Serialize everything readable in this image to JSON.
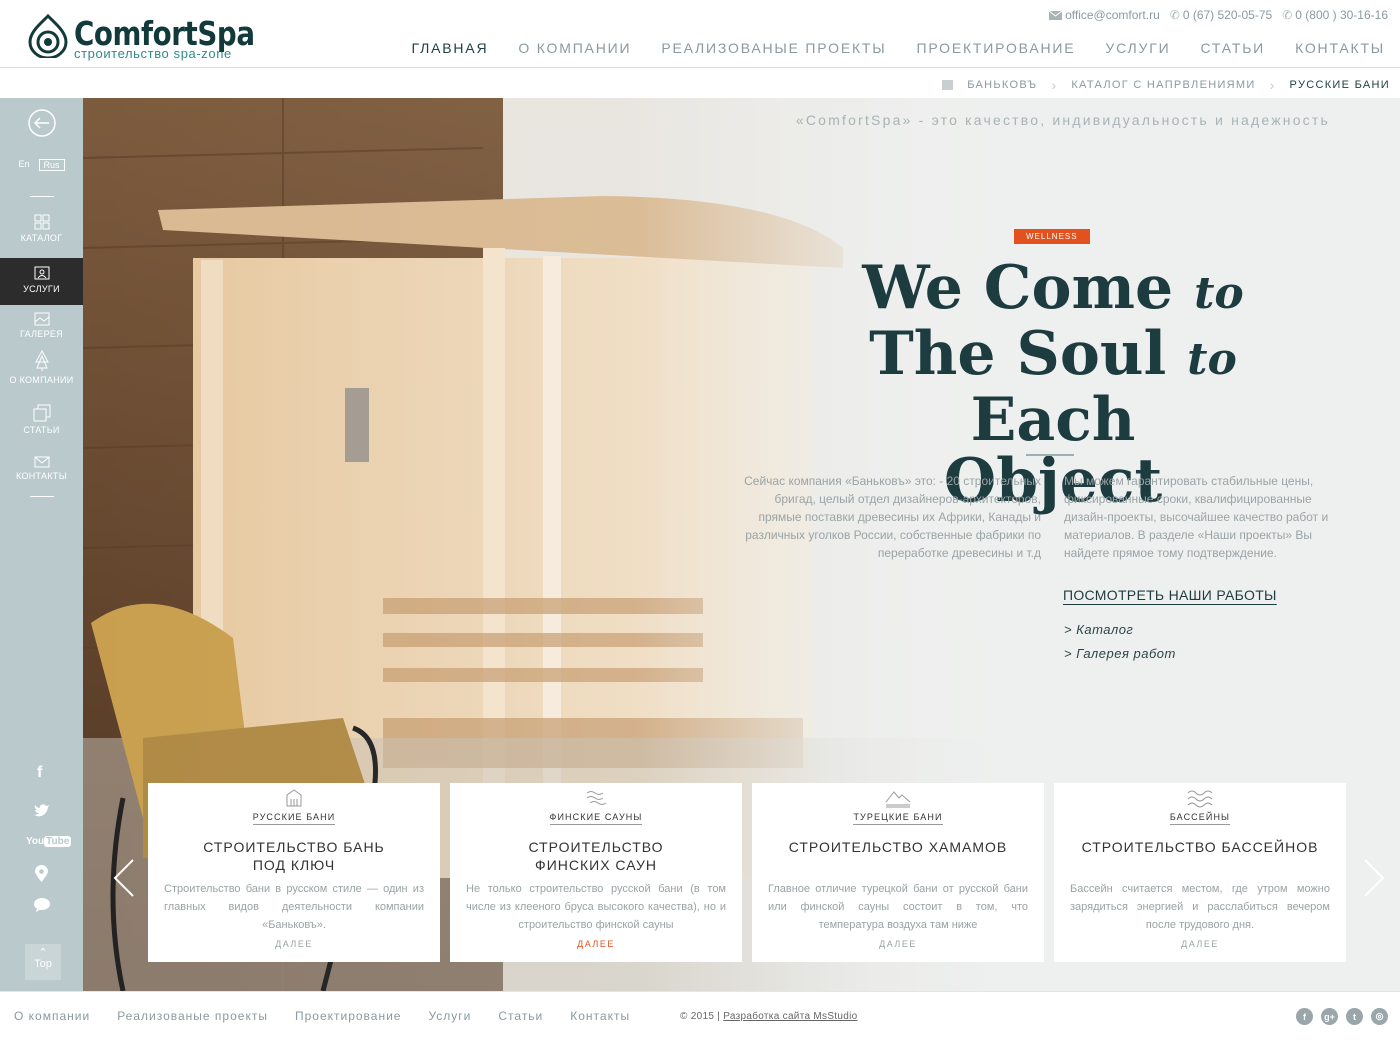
{
  "logo": {
    "name": "ComfortSpa",
    "subtitle": "строительство spa-zone"
  },
  "contacts": {
    "email": "office@comfort.ru",
    "phone1": "0 (67) 520-05-75",
    "phone2": "0 (800 )  30-16-16"
  },
  "nav": [
    "ГЛАВНАЯ",
    "О КОМПАНИИ",
    "РЕАЛИЗОВАНЫЕ ПРОЕКТЫ",
    "ПРОЕКТИРОВАНИЕ",
    "УСЛУГИ",
    "СТАТЬИ",
    "КОНТАКТЫ"
  ],
  "breadcrumb": {
    "home": "БАНЬКОВЪ",
    "mid": "КАТАЛОГ С НАПРВЛЕНИЯМИ",
    "current": "РУССКИЕ БАНИ"
  },
  "sidebar": {
    "lang_en": "En",
    "lang_ru": "Rus",
    "items": [
      "КАТАЛОГ",
      "УСЛУГИ",
      "ГАЛЕРЕЯ",
      "О КОМПАНИИ",
      "СТАТЬИ",
      "КОНТАКТЫ"
    ],
    "top_label": "Top"
  },
  "hero": {
    "tagline": "«ComfortSpa» - это качество, индивидуальность и надежность",
    "badge": "WELLNESS",
    "title_1": "We Come",
    "title_to1": "to",
    "title_2a": "The Soul",
    "title_to2": "to",
    "title_2b": "Each",
    "title_3": "Object",
    "para_left": "Сейчас компания «Баньковъ» это: -  20 строительных бригад, целый отдел дизайнеров-архитекторов, прямые поставки древесины их Африки, Канады и различных уголков России, собственные фабрики по переработке древесины и т.д",
    "para_right": "Мы можем гарантировать стабильные цены, фиксированные сроки, квалифицированные дизайн-проекты, высочайшее качество работ и материалов. В разделе «Наши проекты» Вы найдете прямое тому подтверждение.",
    "cta": "ПОСМОТРЕТЬ НАШИ РАБОТЫ",
    "link1": "> Каталог",
    "link2": "> Галерея  работ"
  },
  "cards": [
    {
      "tag": "РУССКИЕ БАНИ",
      "title": "СТРОИТЕЛЬСТВО БАНЬ\nПОД КЛЮЧ",
      "text": "Строительство бани в русском стиле — один из главных видов деятельности компании «Баньковъ».",
      "more": "ДАЛЕЕ",
      "icon": "bath-house-icon"
    },
    {
      "tag": "ФИНСКИЕ САУНЫ",
      "title": "СТРОИТЕЛЬСТВО\nФИНСКИХ САУН",
      "text": "Не только строительство русской бани (в том числе из клееного бруса высокого качества), но и строительство финской сауны",
      "more": "ДАЛЕЕ",
      "icon": "steam-icon"
    },
    {
      "tag": "ТУРЕЦКИЕ БАНИ",
      "title": "СТРОИТЕЛЬСТВО ХАМАМОВ",
      "text": "Главное отличие турецкой бани от русской бани или финской сауны состоит в том, что температура воздуха там ниже",
      "more": "ДАЛЕЕ",
      "icon": "mountains-icon"
    },
    {
      "tag": "БАССЕЙНЫ",
      "title": "СТРОИТЕЛЬСТВО БАССЕЙНОВ",
      "text": "Бассейн считается местом, где утром можно зарядиться энергией и расслабиться вечером после трудового дня.",
      "more": "ДАЛЕЕ",
      "icon": "waves-icon"
    }
  ],
  "footer": {
    "links": [
      "О компании",
      "Реализованые проекты",
      "Проектирование",
      "Услуги",
      "Статьи",
      "Контакты"
    ],
    "year": "© 2015",
    "dev": "Разработка сайта MsStudio"
  },
  "colors": {
    "accent": "#e2521f",
    "dark": "#1d3c40",
    "sidebar": "#b9c9cc"
  }
}
